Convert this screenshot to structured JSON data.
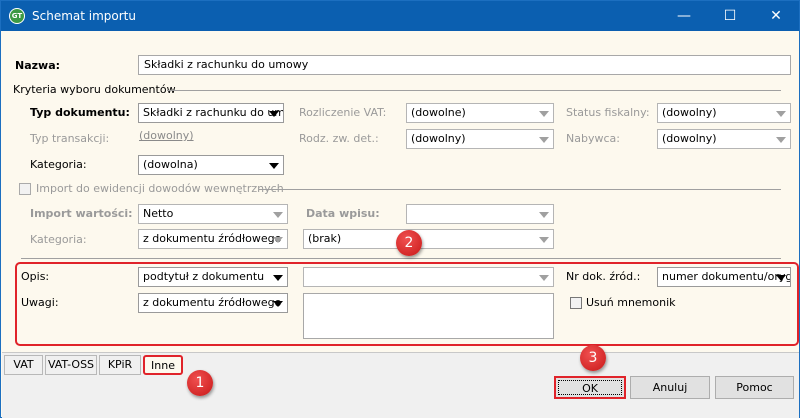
{
  "window": {
    "title": "Schemat importu",
    "minimize": "—",
    "maximize": "☐",
    "close": "✕"
  },
  "form": {
    "nazwa_label": "Nazwa:",
    "nazwa_value": "Składki z rachunku do umowy",
    "kryteria_label": "Kryteria wyboru dokumentów",
    "typ_dok_label": "Typ dokumentu:",
    "typ_dok_value": "Składki z rachunku do umowy",
    "rozl_vat_label": "Rozliczenie VAT:",
    "rozl_vat_value": "(dowolne)",
    "status_label": "Status fiskalny:",
    "status_value": "(dowolny)",
    "typ_trans_label": "Typ transakcji:",
    "typ_trans_value": "(dowolny)",
    "rodz_label": "Rodz. zw. det.:",
    "rodz_value": "(dowolny)",
    "nabywca_label": "Nabywca:",
    "nabywca_value": "(dowolny)",
    "kategoria_label": "Kategoria:",
    "kategoria_value": "(dowolna)",
    "import_ewid_label": "Import do ewidencji dowodów wewnętrznych",
    "import_wart_label": "Import wartości:",
    "import_wart_value": "Netto",
    "data_wpisu_label": "Data wpisu:",
    "data_wpisu_value": "",
    "kategoria2_label": "Kategoria:",
    "kategoria2_value": "z dokumentu źródłowego",
    "kategoria2_extra": "(brak)",
    "opis_label": "Opis:",
    "opis_value": "podtytuł z dokumentu",
    "opis_extra": "",
    "nr_dok_label": "Nr dok. źród.:",
    "nr_dok_value": "numer dokumentu/oryginalny",
    "uwagi_label": "Uwagi:",
    "uwagi_value": "z dokumentu źródłowego",
    "uwagi_text": "",
    "usun_label": "Usuń mnemonik"
  },
  "tabs": [
    {
      "label": "VAT"
    },
    {
      "label": "VAT-OSS"
    },
    {
      "label": "KPiR"
    },
    {
      "label": "Inne",
      "active": true
    }
  ],
  "buttons": {
    "ok": "OK",
    "cancel": "Anuluj",
    "help": "Pomoc"
  },
  "badges": [
    "1",
    "2",
    "3"
  ],
  "colors": {
    "titlebar": "#0b5fb0",
    "highlight": "#e0232a",
    "background": "#fdf9ee"
  }
}
